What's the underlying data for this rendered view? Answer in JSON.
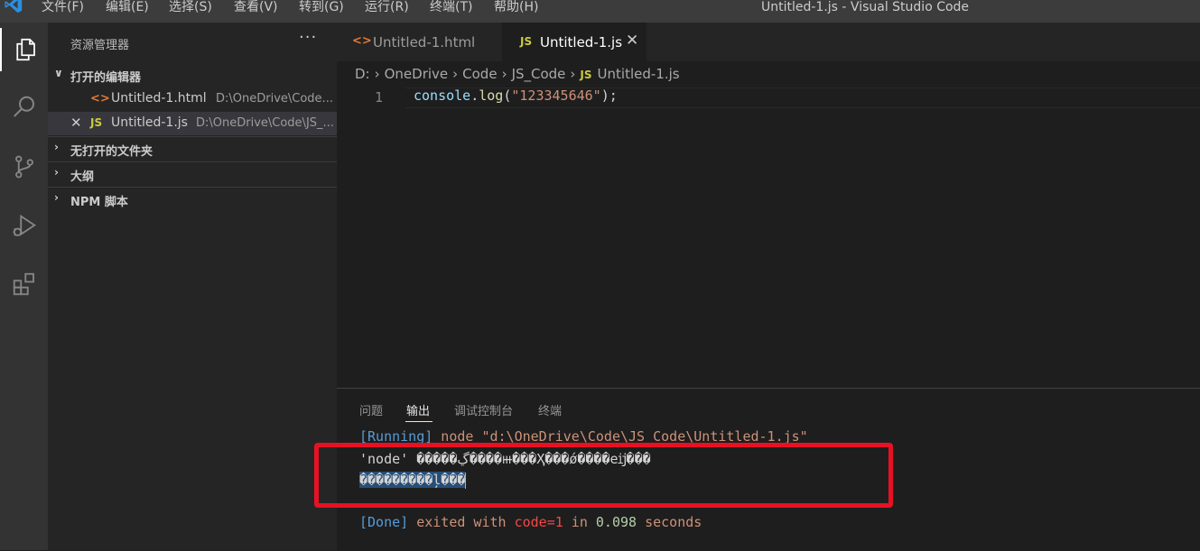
{
  "titlebar": {
    "menu": [
      "文件(F)",
      "编辑(E)",
      "选择(S)",
      "查看(V)",
      "转到(G)",
      "运行(R)",
      "终端(T)",
      "帮助(H)"
    ],
    "window_title": "Untitled-1.js - Visual Studio Code",
    "logo_icon": "vscode-logo-icon"
  },
  "activitybar": {
    "icons": [
      "explorer-icon",
      "search-icon",
      "source-control-icon",
      "run-debug-icon",
      "extensions-icon"
    ]
  },
  "sidebar": {
    "title": "资源管理器",
    "more": "···",
    "open_editors": {
      "label": "打开的编辑器",
      "items": [
        {
          "icon_text": "<>",
          "name": "Untitled-1.html",
          "path": "D:\\OneDrive\\Code..."
        },
        {
          "icon_text": "JS",
          "name": "Untitled-1.js",
          "path": "D:\\OneDrive\\Code\\JS_...",
          "close": "✕"
        }
      ]
    },
    "sections": [
      "无打开的文件夹",
      "大纲",
      "NPM 脚本"
    ]
  },
  "tabs": [
    {
      "icon_text": "<>",
      "label": "Untitled-1.html"
    },
    {
      "icon_text": "JS",
      "label": "Untitled-1.js",
      "close": "✕"
    }
  ],
  "breadcrumb": {
    "parts": [
      "D:",
      "OneDrive",
      "Code",
      "JS_Code"
    ],
    "file_icon": "JS",
    "file": "Untitled-1.js",
    "separator": "›"
  },
  "editor": {
    "line_number": "1",
    "code": {
      "obj": "console",
      "dot": ".",
      "fn": "log",
      "open": "(",
      "str": "\"123345646\"",
      "close": ");"
    }
  },
  "panel": {
    "tabs": [
      "问题",
      "输出",
      "调试控制台",
      "终端"
    ],
    "active_tab": "输出",
    "output": {
      "running_tag": "[Running]",
      "running_cmd": " node \"d:\\OneDrive\\Code\\JS_Code\\Untitled-1.js\"",
      "garbled_1": "'node' �����ڲ����ⲿ���Ҳ���ǿ����еĳ���",
      "garbled_2": "���������ļ���",
      "done_tag": "[Done]",
      "done_exited": " exited with ",
      "done_code": "code=1",
      "done_in": " in ",
      "done_time": "0.098",
      "done_seconds": " seconds"
    }
  },
  "colors": {
    "annotation_red": "#e81123",
    "accent_blue": "#007acc"
  }
}
